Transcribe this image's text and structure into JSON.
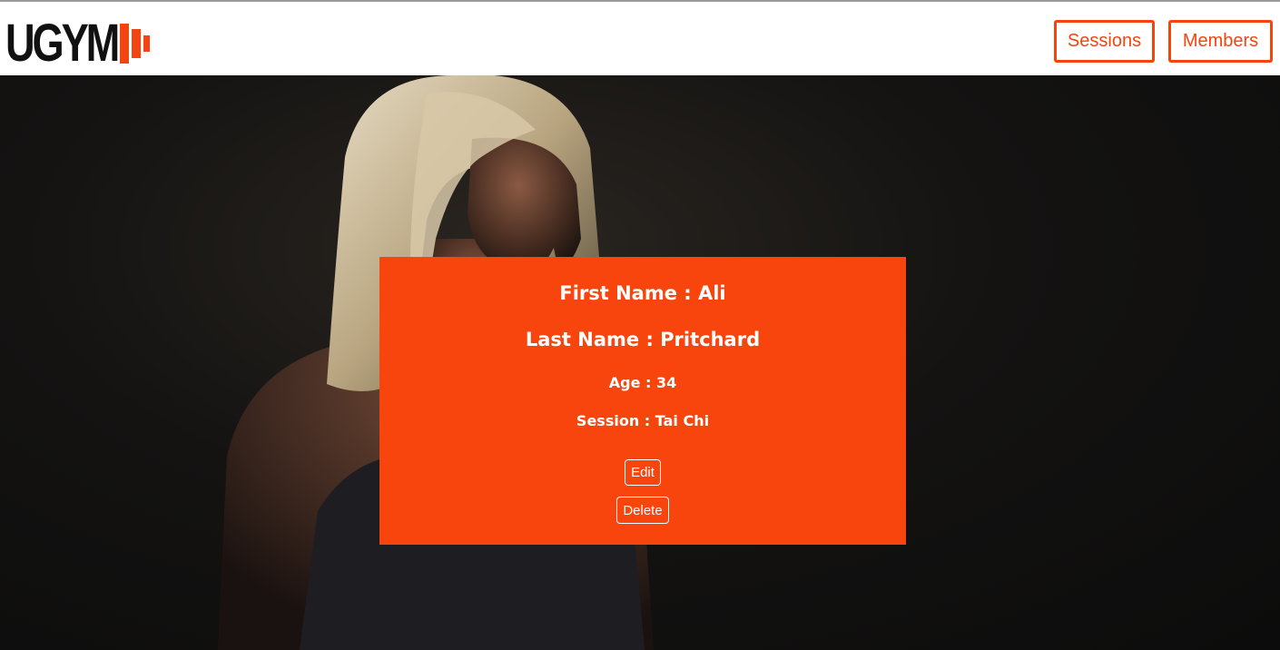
{
  "brand": {
    "logo_text": "UGYM",
    "accent_color": "#f4440f"
  },
  "nav": {
    "sessions_label": "Sessions",
    "members_label": "Members"
  },
  "hero": {
    "image": "athlete-woman-photo",
    "background_color": "#121212"
  },
  "member": {
    "first_name_line": "First Name : Ali",
    "last_name_line": "Last Name : Pritchard",
    "age_line": "Age : 34",
    "session_line": "Session : Tai Chi",
    "card_color": "#f8450e"
  },
  "actions": {
    "edit_label": "Edit",
    "delete_label": "Delete"
  }
}
